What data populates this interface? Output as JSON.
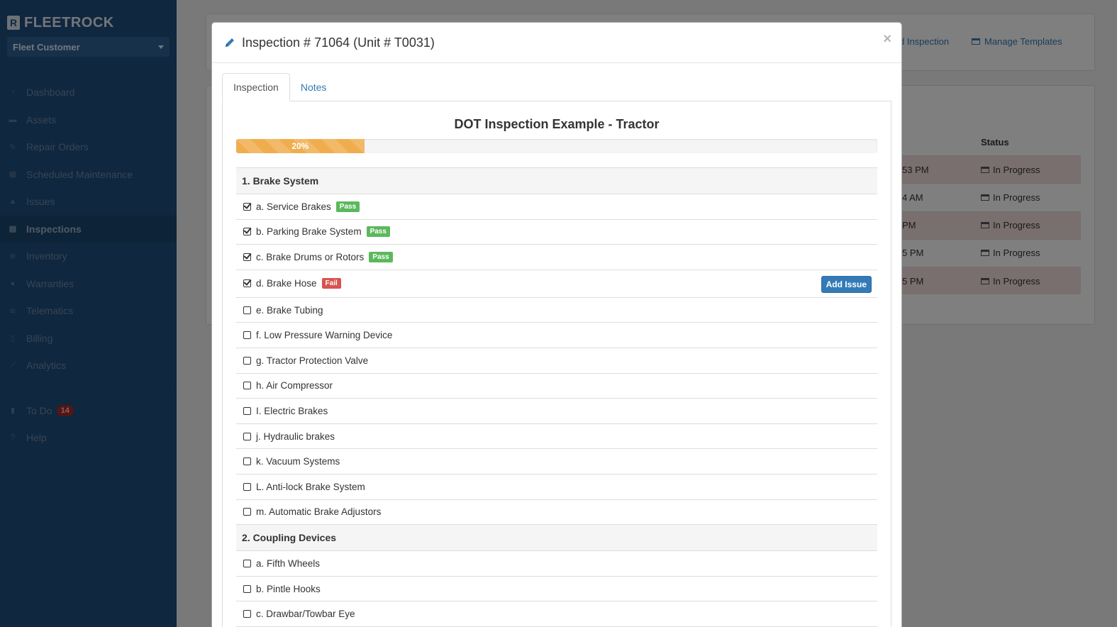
{
  "brand": {
    "name": "FLEETROCK",
    "logo_letter": "R"
  },
  "customer_select": {
    "value": "Fleet Customer"
  },
  "nav": [
    {
      "label": "Dashboard",
      "icon": "dashboard-icon"
    },
    {
      "label": "Assets",
      "icon": "truck-icon"
    },
    {
      "label": "Repair Orders",
      "icon": "wrench-icon"
    },
    {
      "label": "Scheduled Maintenance",
      "icon": "calendar-icon"
    },
    {
      "label": "Issues",
      "icon": "warning-icon"
    },
    {
      "label": "Inspections",
      "icon": "list-icon",
      "active": true
    },
    {
      "label": "Inventory",
      "icon": "cogs-icon"
    },
    {
      "label": "Warranties",
      "icon": "certificate-icon"
    },
    {
      "label": "Telematics",
      "icon": "wifi-icon"
    },
    {
      "label": "Billing",
      "icon": "file-icon"
    },
    {
      "label": "Analytics",
      "icon": "line-chart-icon"
    }
  ],
  "nav_bottom": [
    {
      "label": "To Do",
      "icon": "book-icon",
      "badge": "14"
    },
    {
      "label": "Help",
      "icon": "question-icon"
    }
  ],
  "background": {
    "links": [
      "d Inspection",
      "Manage Templates"
    ],
    "status_header": "Status",
    "rows": [
      {
        "time": "53 PM",
        "status": "In Progress"
      },
      {
        "time": "4 AM",
        "status": "In Progress"
      },
      {
        "time": "PM",
        "status": "In Progress"
      },
      {
        "time": "5 PM",
        "status": "In Progress"
      },
      {
        "time": "5 PM",
        "status": "In Progress"
      }
    ]
  },
  "modal": {
    "title": "Inspection # 71064 (Unit # T0031)",
    "close": "×",
    "tabs": [
      "Inspection",
      "Notes"
    ],
    "form_title": "DOT Inspection Example - Tractor",
    "progress": {
      "value": 20,
      "label": "20%"
    },
    "add_issue_label": "Add Issue",
    "sections": [
      {
        "title": "1. Brake System",
        "items": [
          {
            "label": "a. Service Brakes",
            "checked": true,
            "result": "Pass"
          },
          {
            "label": "b. Parking Brake System",
            "checked": true,
            "result": "Pass"
          },
          {
            "label": "c. Brake Drums or Rotors",
            "checked": true,
            "result": "Pass"
          },
          {
            "label": "d. Brake Hose",
            "checked": true,
            "result": "Fail"
          },
          {
            "label": "e. Brake Tubing",
            "checked": false
          },
          {
            "label": "f. Low Pressure Warning Device",
            "checked": false
          },
          {
            "label": "g. Tractor Protection Valve",
            "checked": false
          },
          {
            "label": "h. Air Compressor",
            "checked": false
          },
          {
            "label": "I. Electric Brakes",
            "checked": false
          },
          {
            "label": "j. Hydraulic brakes",
            "checked": false
          },
          {
            "label": "k. Vacuum Systems",
            "checked": false
          },
          {
            "label": "L. Anti-lock Brake System",
            "checked": false
          },
          {
            "label": "m. Automatic Brake Adjustors",
            "checked": false
          }
        ]
      },
      {
        "title": "2. Coupling Devices",
        "items": [
          {
            "label": "a. Fifth Wheels",
            "checked": false
          },
          {
            "label": "b. Pintle Hooks",
            "checked": false
          },
          {
            "label": "c. Drawbar/Towbar Eye",
            "checked": false
          }
        ]
      }
    ]
  }
}
